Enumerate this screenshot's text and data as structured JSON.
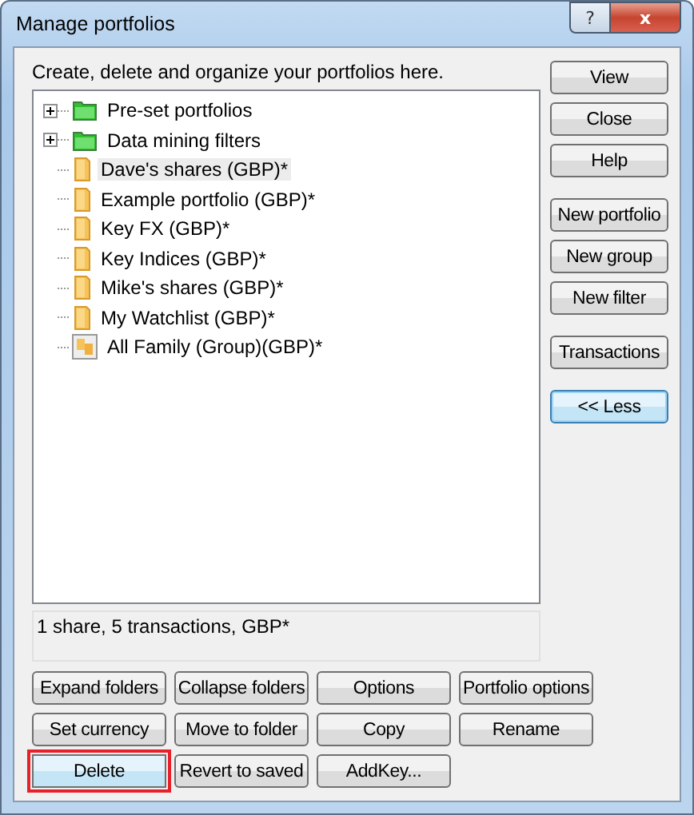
{
  "window": {
    "title": "Manage portfolios",
    "help_button": "?",
    "close_button": "x"
  },
  "instructions": "Create, delete and organize your portfolios here.",
  "tree": [
    {
      "label": "Pre-set portfolios",
      "kind": "folder",
      "expanded": false,
      "selected": false
    },
    {
      "label": "Data mining filters",
      "kind": "folder",
      "expanded": false,
      "selected": false
    },
    {
      "label": "Dave's shares (GBP)*",
      "kind": "portfolio",
      "selected": true
    },
    {
      "label": "Example portfolio (GBP)*",
      "kind": "portfolio",
      "selected": false
    },
    {
      "label": "Key FX (GBP)*",
      "kind": "portfolio",
      "selected": false
    },
    {
      "label": "Key Indices (GBP)*",
      "kind": "portfolio",
      "selected": false
    },
    {
      "label": "Mike's shares (GBP)*",
      "kind": "portfolio",
      "selected": false
    },
    {
      "label": "My Watchlist (GBP)*",
      "kind": "portfolio",
      "selected": false
    },
    {
      "label": "All Family (Group)(GBP)*",
      "kind": "group",
      "selected": false
    }
  ],
  "status": "1 share, 5 transactions, GBP*",
  "side_buttons": [
    [
      {
        "label": "View",
        "default": false
      },
      {
        "label": "Close",
        "default": false
      },
      {
        "label": "Help",
        "default": false
      }
    ],
    [
      {
        "label": "New portfolio",
        "default": false
      },
      {
        "label": "New group",
        "default": false
      },
      {
        "label": "New filter",
        "default": false
      }
    ],
    [
      {
        "label": "Transactions",
        "default": false
      }
    ],
    [
      {
        "label": "<< Less",
        "default": true
      }
    ]
  ],
  "bottom_buttons": [
    {
      "label": "Expand folders",
      "highlighted": false
    },
    {
      "label": "Collapse folders",
      "highlighted": false
    },
    {
      "label": "Options",
      "highlighted": false
    },
    {
      "label": "Portfolio options",
      "highlighted": false
    },
    {
      "label": "Set currency",
      "highlighted": false
    },
    {
      "label": "Move to folder",
      "highlighted": false
    },
    {
      "label": "Copy",
      "highlighted": false
    },
    {
      "label": "Rename",
      "highlighted": false
    },
    {
      "label": "Delete",
      "highlighted": true
    },
    {
      "label": "Revert to saved",
      "highlighted": false
    },
    {
      "label": "AddKey...",
      "highlighted": false
    }
  ]
}
